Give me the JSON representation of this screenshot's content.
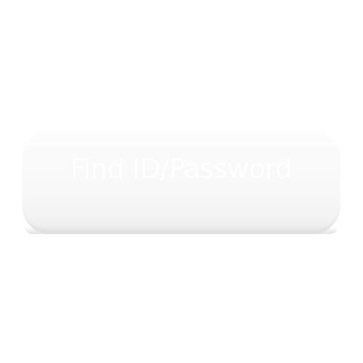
{
  "find_button": {
    "label": "Find ID/Password"
  },
  "colors": {
    "background": "#ffffff",
    "button_face": "#f8f8f8",
    "button_rim": "#e6e6e6",
    "label_text": "#ffffff"
  }
}
